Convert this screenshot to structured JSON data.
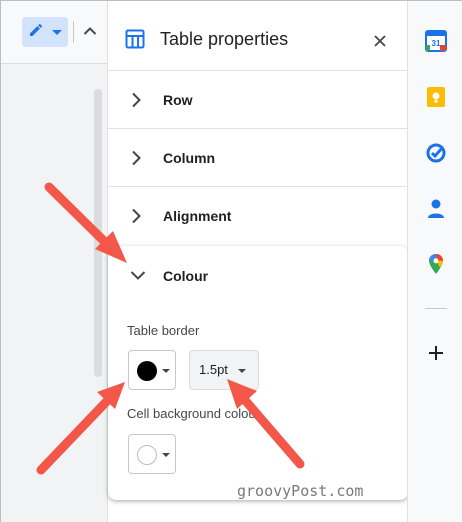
{
  "panel": {
    "title": "Table properties",
    "sections": [
      {
        "label": "Row",
        "expanded": false
      },
      {
        "label": "Column",
        "expanded": false
      },
      {
        "label": "Alignment",
        "expanded": false
      },
      {
        "label": "Colour",
        "expanded": true
      }
    ],
    "colour": {
      "table_border_label": "Table border",
      "border_colour": "#000000",
      "border_width": "1.5pt",
      "cell_background_label": "Cell background colour",
      "cell_background_colour": "#ffffff"
    }
  },
  "side_panel": {
    "icons": [
      "calendar-icon",
      "keep-icon",
      "tasks-icon",
      "contacts-icon",
      "maps-icon",
      "add-icon"
    ],
    "calendar_day": "31"
  },
  "watermark": "groovyPost.com",
  "colors": {
    "accent_blue": "#1a73e8",
    "arrow_red": "#f2574a",
    "edit_mode_bg": "#d3e3fd"
  }
}
